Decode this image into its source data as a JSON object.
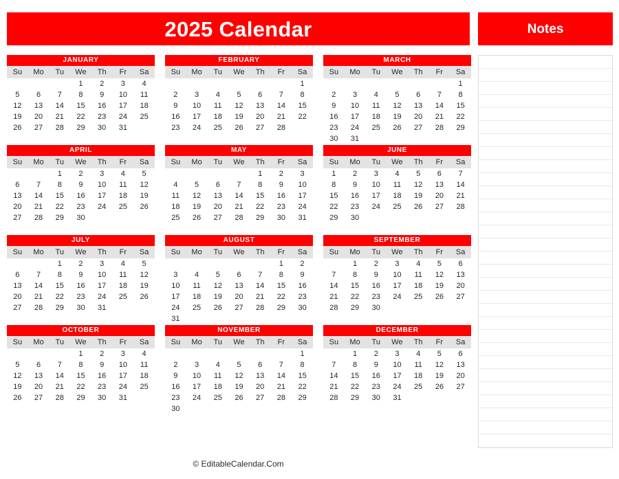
{
  "header": {
    "main_title": "2025 Calendar",
    "notes_title": "Notes"
  },
  "footer": {
    "credit": "© EditableCalendar.Com"
  },
  "colors": {
    "brand_red": "#FF0000",
    "sunday": "#FF0000",
    "saturday": "#ED7D31",
    "weekday": "#262626",
    "weekday_header_bg": "#E3E3E3",
    "note_rule": "#E8E8E8"
  },
  "weekday_headers": [
    "Su",
    "Mo",
    "Tu",
    "We",
    "Th",
    "Fr",
    "Sa"
  ],
  "notes": {
    "line_count": 30,
    "lines": [
      "",
      "",
      "",
      "",
      "",
      "",
      "",
      "",
      "",
      "",
      "",
      "",
      "",
      "",
      "",
      "",
      "",
      "",
      "",
      "",
      "",
      "",
      "",
      "",
      "",
      "",
      "",
      "",
      "",
      ""
    ]
  },
  "year": 2025,
  "months": [
    {
      "name": "JANUARY",
      "index": 1,
      "first_weekday": 3,
      "days_in_month": 31,
      "weeks": [
        [
          "",
          "",
          "",
          "1",
          "2",
          "3",
          "4"
        ],
        [
          "5",
          "6",
          "7",
          "8",
          "9",
          "10",
          "11"
        ],
        [
          "12",
          "13",
          "14",
          "15",
          "16",
          "17",
          "18"
        ],
        [
          "19",
          "20",
          "21",
          "22",
          "23",
          "24",
          "25"
        ],
        [
          "26",
          "27",
          "28",
          "29",
          "30",
          "31",
          ""
        ],
        [
          "",
          "",
          "",
          "",
          "",
          "",
          ""
        ]
      ]
    },
    {
      "name": "FEBRUARY",
      "index": 2,
      "first_weekday": 6,
      "days_in_month": 28,
      "weeks": [
        [
          "",
          "",
          "",
          "",
          "",
          "",
          "1"
        ],
        [
          "2",
          "3",
          "4",
          "5",
          "6",
          "7",
          "8"
        ],
        [
          "9",
          "10",
          "11",
          "12",
          "13",
          "14",
          "15"
        ],
        [
          "16",
          "17",
          "18",
          "19",
          "20",
          "21",
          "22"
        ],
        [
          "23",
          "24",
          "25",
          "26",
          "27",
          "28",
          ""
        ],
        [
          "",
          "",
          "",
          "",
          "",
          "",
          ""
        ]
      ]
    },
    {
      "name": "MARCH",
      "index": 3,
      "first_weekday": 6,
      "days_in_month": 31,
      "weeks": [
        [
          "",
          "",
          "",
          "",
          "",
          "",
          "1"
        ],
        [
          "2",
          "3",
          "4",
          "5",
          "6",
          "7",
          "8"
        ],
        [
          "9",
          "10",
          "11",
          "12",
          "13",
          "14",
          "15"
        ],
        [
          "16",
          "17",
          "18",
          "19",
          "20",
          "21",
          "22"
        ],
        [
          "23",
          "24",
          "25",
          "26",
          "27",
          "28",
          "29"
        ],
        [
          "30",
          "31",
          "",
          "",
          "",
          "",
          ""
        ]
      ]
    },
    {
      "name": "APRIL",
      "index": 4,
      "first_weekday": 2,
      "days_in_month": 30,
      "weeks": [
        [
          "",
          "",
          "1",
          "2",
          "3",
          "4",
          "5"
        ],
        [
          "6",
          "7",
          "8",
          "9",
          "10",
          "11",
          "12"
        ],
        [
          "13",
          "14",
          "15",
          "16",
          "17",
          "18",
          "19"
        ],
        [
          "20",
          "21",
          "22",
          "23",
          "24",
          "25",
          "26"
        ],
        [
          "27",
          "28",
          "29",
          "30",
          "",
          "",
          ""
        ],
        [
          "",
          "",
          "",
          "",
          "",
          "",
          ""
        ]
      ]
    },
    {
      "name": "MAY",
      "index": 5,
      "first_weekday": 4,
      "days_in_month": 31,
      "weeks": [
        [
          "",
          "",
          "",
          "",
          "1",
          "2",
          "3"
        ],
        [
          "4",
          "5",
          "6",
          "7",
          "8",
          "9",
          "10"
        ],
        [
          "11",
          "12",
          "13",
          "14",
          "15",
          "16",
          "17"
        ],
        [
          "18",
          "19",
          "20",
          "21",
          "22",
          "23",
          "24"
        ],
        [
          "25",
          "26",
          "27",
          "28",
          "29",
          "30",
          "31"
        ],
        [
          "",
          "",
          "",
          "",
          "",
          "",
          ""
        ]
      ]
    },
    {
      "name": "JUNE",
      "index": 6,
      "first_weekday": 0,
      "days_in_month": 30,
      "weeks": [
        [
          "1",
          "2",
          "3",
          "4",
          "5",
          "6",
          "7"
        ],
        [
          "8",
          "9",
          "10",
          "11",
          "12",
          "13",
          "14"
        ],
        [
          "15",
          "16",
          "17",
          "18",
          "19",
          "20",
          "21"
        ],
        [
          "22",
          "23",
          "24",
          "25",
          "26",
          "27",
          "28"
        ],
        [
          "29",
          "30",
          "",
          "",
          "",
          "",
          ""
        ],
        [
          "",
          "",
          "",
          "",
          "",
          "",
          ""
        ]
      ]
    },
    {
      "name": "JULY",
      "index": 7,
      "first_weekday": 2,
      "days_in_month": 31,
      "weeks": [
        [
          "",
          "",
          "1",
          "2",
          "3",
          "4",
          "5"
        ],
        [
          "6",
          "7",
          "8",
          "9",
          "10",
          "11",
          "12"
        ],
        [
          "13",
          "14",
          "15",
          "16",
          "17",
          "18",
          "19"
        ],
        [
          "20",
          "21",
          "22",
          "23",
          "24",
          "25",
          "26"
        ],
        [
          "27",
          "28",
          "29",
          "30",
          "31",
          "",
          ""
        ],
        [
          "",
          "",
          "",
          "",
          "",
          "",
          ""
        ]
      ]
    },
    {
      "name": "AUGUST",
      "index": 8,
      "first_weekday": 5,
      "days_in_month": 31,
      "weeks": [
        [
          "",
          "",
          "",
          "",
          "",
          "1",
          "2"
        ],
        [
          "3",
          "4",
          "5",
          "6",
          "7",
          "8",
          "9"
        ],
        [
          "10",
          "11",
          "12",
          "13",
          "14",
          "15",
          "16"
        ],
        [
          "17",
          "18",
          "19",
          "20",
          "21",
          "22",
          "23"
        ],
        [
          "24",
          "25",
          "26",
          "27",
          "28",
          "29",
          "30"
        ],
        [
          "31",
          "",
          "",
          "",
          "",
          "",
          ""
        ]
      ]
    },
    {
      "name": "SEPTEMBER",
      "index": 9,
      "first_weekday": 1,
      "days_in_month": 30,
      "weeks": [
        [
          "",
          "1",
          "2",
          "3",
          "4",
          "5",
          "6"
        ],
        [
          "7",
          "8",
          "9",
          "10",
          "11",
          "12",
          "13"
        ],
        [
          "14",
          "15",
          "16",
          "17",
          "18",
          "19",
          "20"
        ],
        [
          "21",
          "22",
          "23",
          "24",
          "25",
          "26",
          "27"
        ],
        [
          "28",
          "29",
          "30",
          "",
          "",
          "",
          ""
        ],
        [
          "",
          "",
          "",
          "",
          "",
          "",
          ""
        ]
      ]
    },
    {
      "name": "OCTOBER",
      "index": 10,
      "first_weekday": 3,
      "days_in_month": 31,
      "weeks": [
        [
          "",
          "",
          "",
          "1",
          "2",
          "3",
          "4"
        ],
        [
          "5",
          "6",
          "7",
          "8",
          "9",
          "10",
          "11"
        ],
        [
          "12",
          "13",
          "14",
          "15",
          "16",
          "17",
          "18"
        ],
        [
          "19",
          "20",
          "21",
          "22",
          "23",
          "24",
          "25"
        ],
        [
          "26",
          "27",
          "28",
          "29",
          "30",
          "31",
          ""
        ],
        [
          "",
          "",
          "",
          "",
          "",
          "",
          ""
        ]
      ]
    },
    {
      "name": "NOVEMBER",
      "index": 11,
      "first_weekday": 6,
      "days_in_month": 30,
      "weeks": [
        [
          "",
          "",
          "",
          "",
          "",
          "",
          "1"
        ],
        [
          "2",
          "3",
          "4",
          "5",
          "6",
          "7",
          "8"
        ],
        [
          "9",
          "10",
          "11",
          "12",
          "13",
          "14",
          "15"
        ],
        [
          "16",
          "17",
          "18",
          "19",
          "20",
          "21",
          "22"
        ],
        [
          "23",
          "24",
          "25",
          "26",
          "27",
          "28",
          "29"
        ],
        [
          "30",
          "",
          "",
          "",
          "",
          "",
          ""
        ]
      ]
    },
    {
      "name": "DECEMBER",
      "index": 12,
      "first_weekday": 1,
      "days_in_month": 31,
      "weeks": [
        [
          "",
          "1",
          "2",
          "3",
          "4",
          "5",
          "6"
        ],
        [
          "7",
          "8",
          "9",
          "10",
          "11",
          "12",
          "13"
        ],
        [
          "14",
          "15",
          "16",
          "17",
          "18",
          "19",
          "20"
        ],
        [
          "21",
          "22",
          "23",
          "24",
          "25",
          "26",
          "27"
        ],
        [
          "28",
          "29",
          "30",
          "31",
          "",
          "",
          ""
        ],
        [
          "",
          "",
          "",
          "",
          "",
          "",
          ""
        ]
      ]
    }
  ]
}
